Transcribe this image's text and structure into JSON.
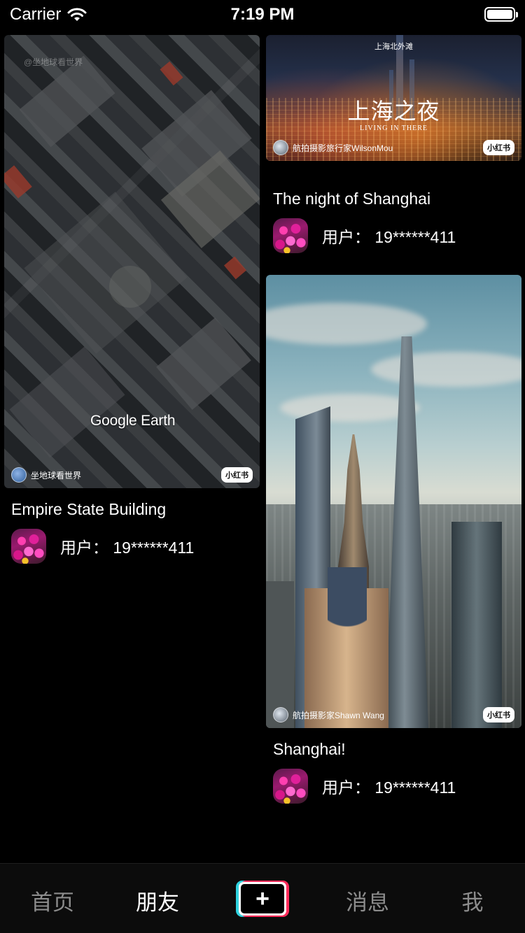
{
  "status_bar": {
    "carrier": "Carrier",
    "time": "7:19 PM"
  },
  "feed": [
    {
      "title": "Empire State Building",
      "author": "用户：  19******411",
      "image": {
        "watermark": "@坐地球看世界",
        "overlay": "Google Earth",
        "source_name": "坐地球看世界",
        "badge": "小红书"
      }
    },
    {
      "title": "The night of Shanghai",
      "author": "用户：  19******411",
      "image": {
        "top_caption": "上海北外滩",
        "headline": "上海之夜",
        "subline": "LIVING IN THERE",
        "source_name": "航拍摄影旅行家WilsonMou",
        "badge": "小红书"
      }
    },
    {
      "title": "Shanghai!",
      "author": "用户：  19******411",
      "image": {
        "source_name": "航拍摄影家Shawn Wang",
        "badge": "小红书"
      }
    }
  ],
  "tabbar": {
    "tabs": [
      "首页",
      "朋友",
      "消息",
      "我"
    ],
    "active": "朋友",
    "add_label": "+"
  },
  "colors": {
    "background": "#000000",
    "tab_inactive": "#8c8c8c",
    "tab_active": "#ffffff",
    "add_left": "#2fd3e0",
    "add_right": "#ff2b5a"
  }
}
